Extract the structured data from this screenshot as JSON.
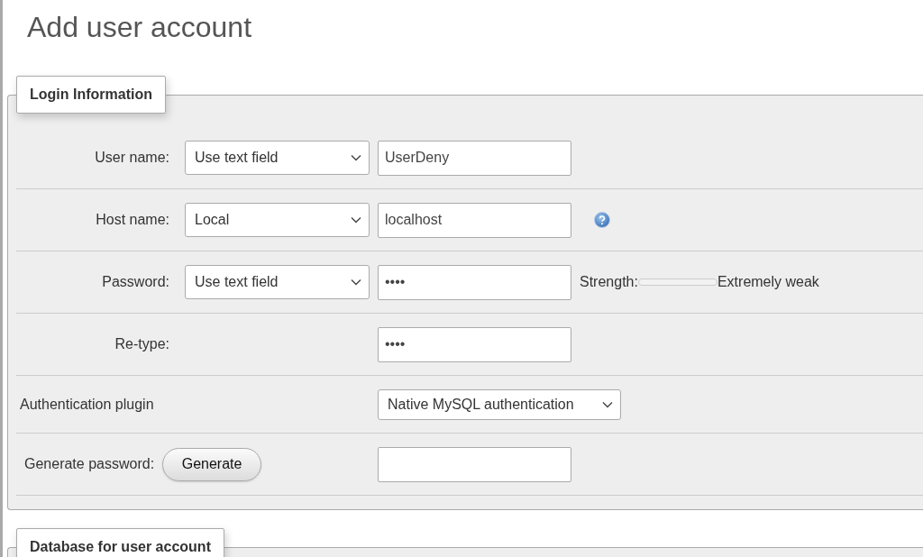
{
  "title": "Add user account",
  "sections": [
    {
      "legend": "Login Information",
      "rows": [
        {
          "kind": "field",
          "label": "User name:",
          "select": "Use text field",
          "value": "UserDeny"
        },
        {
          "kind": "field",
          "label": "Host name:",
          "select": "Local",
          "value": "localhost",
          "help": true
        },
        {
          "kind": "field",
          "label": "Password:",
          "select": "Use text field",
          "value": "••••",
          "strength": {
            "label": "Strength:",
            "level": 0,
            "reading": "Extremely weak"
          }
        },
        {
          "kind": "field",
          "label": "Re-type:",
          "value": "••••"
        },
        {
          "kind": "plugin",
          "label": "Authentication plugin",
          "select": "Native MySQL authentication"
        },
        {
          "kind": "generate",
          "label": "Generate password:",
          "button": "Generate"
        }
      ]
    },
    {
      "legend": "Database for user account"
    }
  ]
}
